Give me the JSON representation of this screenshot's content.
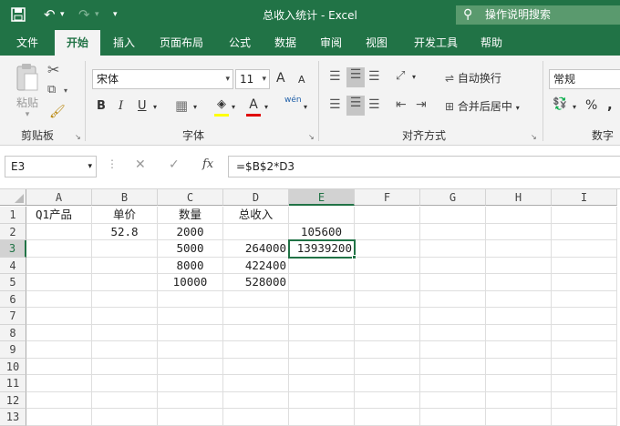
{
  "titlebar": {
    "save_icon": "save-icon",
    "undo_icon": "undo-icon",
    "redo_icon": "redo-icon",
    "title": "总收入统计  -  Excel",
    "tellme": "操作说明搜索"
  },
  "tabs": [
    "文件",
    "开始",
    "插入",
    "页面布局",
    "公式",
    "数据",
    "审阅",
    "视图",
    "开发工具",
    "帮助"
  ],
  "ribbon": {
    "clipboard": {
      "paste": "粘贴",
      "label": "剪贴板"
    },
    "font": {
      "name": "宋体",
      "size": "11",
      "bold": "B",
      "italic": "I",
      "underline": "U",
      "label": "字体",
      "grow": "A",
      "shrink": "A",
      "phonetic": "wén"
    },
    "alignment": {
      "wrap": "自动换行",
      "merge": "合并后居中",
      "label": "对齐方式"
    },
    "number": {
      "format": "常规",
      "percent": "%",
      "comma": ",",
      "label": "数字"
    }
  },
  "formula_bar": {
    "name_box": "E3",
    "formula": "=$B$2*D3"
  },
  "sheet": {
    "columns": [
      "A",
      "B",
      "C",
      "D",
      "E",
      "F",
      "G",
      "H",
      "I"
    ],
    "rows": [
      "1",
      "2",
      "3",
      "4",
      "5",
      "6",
      "7",
      "8",
      "9",
      "10",
      "11",
      "12",
      "13"
    ],
    "cells": {
      "A1": "Q1产品",
      "B1": "单价",
      "C1": "数量",
      "D1": "总收入",
      "B2": "52.8",
      "C2": "2000",
      "E2": "105600",
      "C3": "5000",
      "D3": "264000",
      "E3": "13939200",
      "C4": "8000",
      "D4": "422400",
      "C5": "10000",
      "D5": "528000"
    },
    "selected_cell": "E3"
  },
  "colors": {
    "accent": "#217346",
    "ribbon_bg": "#f3f3f3",
    "gridline": "#dedede"
  }
}
